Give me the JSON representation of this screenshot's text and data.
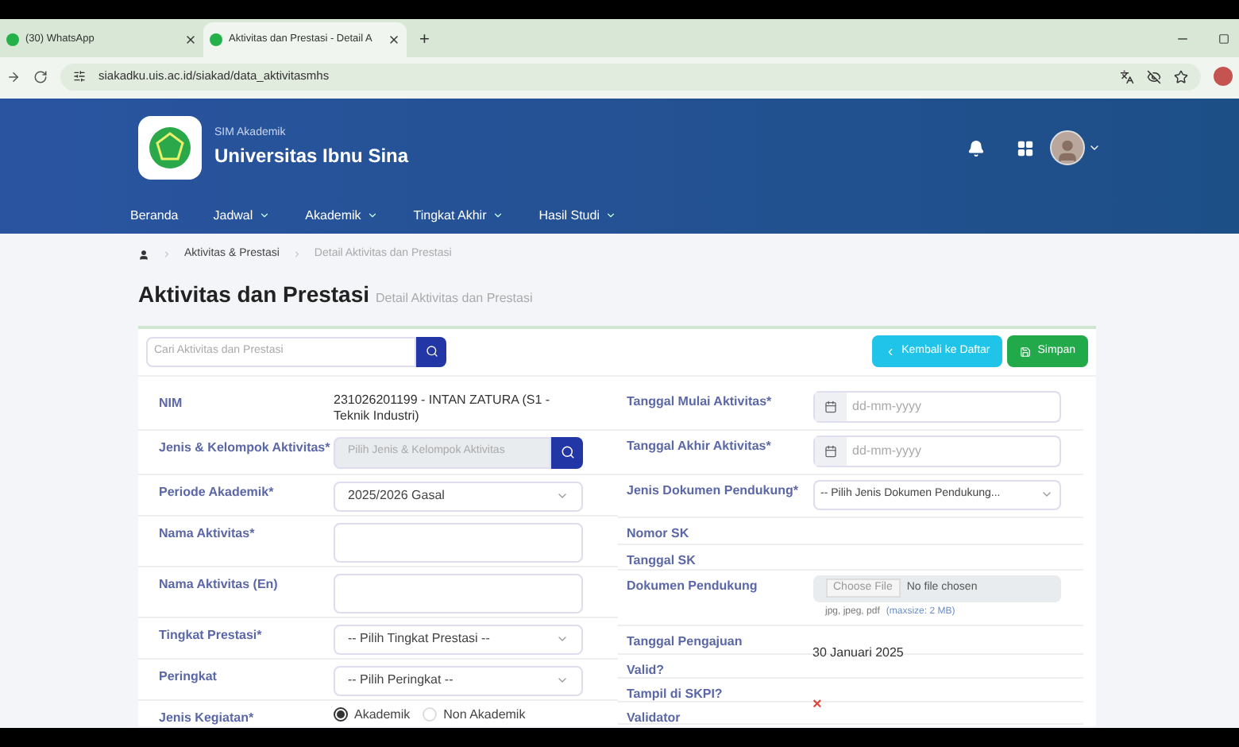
{
  "browser": {
    "tabs": [
      {
        "title": "(30) WhatsApp",
        "selected": false
      },
      {
        "title": "Aktivitas dan Prestasi - Detail A",
        "selected": true
      }
    ],
    "new_tab": "+",
    "url": "siakadku.uis.ac.id/siakad/data_aktivitasmhs"
  },
  "header": {
    "subtitle": "SIM Akademik",
    "title": "Universitas Ibnu Sina",
    "nav": [
      {
        "label": "Beranda",
        "dropdown": false
      },
      {
        "label": "Jadwal",
        "dropdown": true
      },
      {
        "label": "Akademik",
        "dropdown": true
      },
      {
        "label": "Tingkat Akhir",
        "dropdown": true
      },
      {
        "label": "Hasil Studi",
        "dropdown": true
      }
    ]
  },
  "breadcrumb": [
    "Aktivitas & Prestasi",
    "Detail Aktivitas dan Prestasi"
  ],
  "page": {
    "title": "Aktivitas dan Prestasi",
    "subtitle": "Detail Aktivitas dan Prestasi"
  },
  "search": {
    "placeholder": "Cari Aktivitas dan Prestasi"
  },
  "buttons": {
    "back": "Kembali ke Daftar",
    "save": "Simpan"
  },
  "left_fields": [
    {
      "kind": "text",
      "label": "NIM",
      "value": "231026201199 - INTAN ZATURA (S1 - Teknik Industri)"
    },
    {
      "kind": "lookup",
      "label": "Jenis & Kelompok Aktivitas*",
      "placeholder": "Pilih Jenis & Kelompok Aktivitas"
    },
    {
      "kind": "select",
      "label": "Periode Akademik*",
      "value": "2025/2026 Gasal"
    },
    {
      "kind": "textarea",
      "label": "Nama Aktivitas*"
    },
    {
      "kind": "textarea",
      "label": "Nama Aktivitas (En)"
    },
    {
      "kind": "select",
      "label": "Tingkat Prestasi*",
      "value": "-- Pilih Tingkat Prestasi --"
    },
    {
      "kind": "select",
      "label": "Peringkat",
      "value": "-- Pilih Peringkat --"
    },
    {
      "kind": "radio",
      "label": "Jenis Kegiatan*",
      "options": [
        {
          "label": "Akademik",
          "selected": true
        },
        {
          "label": "Non Akademik",
          "selected": false
        }
      ]
    }
  ],
  "right_fields": [
    {
      "kind": "date",
      "label": "Tanggal Mulai Aktivitas*",
      "placeholder": "dd-mm-yyyy"
    },
    {
      "kind": "date",
      "label": "Tanggal Akhir Aktivitas*",
      "placeholder": "dd-mm-yyyy"
    },
    {
      "kind": "select",
      "label": "Jenis Dokumen Pendukung*",
      "value": "-- Pilih Jenis Dokumen Pendukung..."
    },
    {
      "kind": "empty",
      "label": "Nomor SK"
    },
    {
      "kind": "empty",
      "label": "Tanggal SK"
    },
    {
      "kind": "file",
      "label": "Dokumen Pendukung",
      "button": "Choose File",
      "value": "No file chosen",
      "hint": "jpg, jpeg, pdf",
      "hint_note": "(maxsize: 2 MB)"
    },
    {
      "kind": "text",
      "label": "Tanggal Pengajuan",
      "value": "30 Januari 2025"
    },
    {
      "kind": "empty",
      "label": "Valid?"
    },
    {
      "kind": "mark",
      "label": "Tampil di SKPI?",
      "value": "×"
    },
    {
      "kind": "empty",
      "label": "Validator"
    }
  ]
}
